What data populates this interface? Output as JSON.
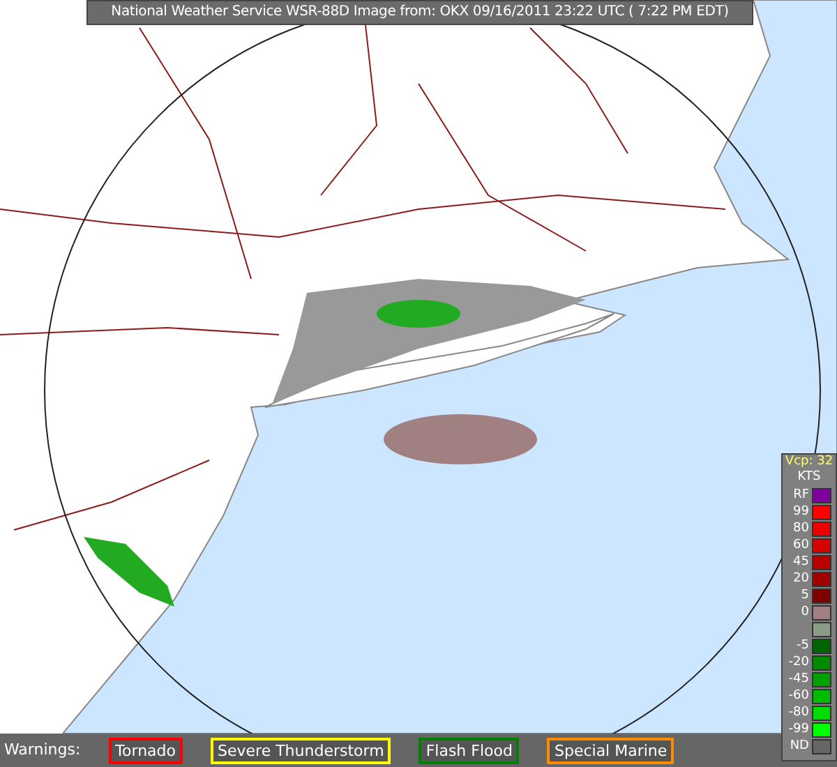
{
  "header": {
    "title": "National Weather Service WSR-88D Image from: OKX 09/16/2011  23:22 UTC ( 7:22 PM EDT)"
  },
  "legend": {
    "mode": "Vcp: 32",
    "unit": "KTS",
    "entries": [
      {
        "label": "RF",
        "color": "#8000a0"
      },
      {
        "label": "99",
        "color": "#ff0000"
      },
      {
        "label": "80",
        "color": "#ee0000"
      },
      {
        "label": "60",
        "color": "#d50000"
      },
      {
        "label": "45",
        "color": "#b80000"
      },
      {
        "label": "20",
        "color": "#a00000"
      },
      {
        "label": "5",
        "color": "#800000"
      },
      {
        "label": "0",
        "color": "#a08080"
      },
      {
        "color": "#8a9c88"
      },
      {
        "label": "-5",
        "color": "#006400"
      },
      {
        "label": "-20",
        "color": "#008a00"
      },
      {
        "label": "-45",
        "color": "#00a200"
      },
      {
        "label": "-60",
        "color": "#00bc00"
      },
      {
        "label": "-80",
        "color": "#00dc00"
      },
      {
        "label": "-99",
        "color": "#00ff00"
      },
      {
        "label": "ND",
        "color": "#666666"
      }
    ]
  },
  "warnings": {
    "label": "Warnings:",
    "items": [
      {
        "label": "Tornado",
        "color": "#ff0000"
      },
      {
        "label": "Severe Thunderstorm",
        "color": "#ffff00"
      },
      {
        "label": "Flash Flood",
        "color": "#008000"
      },
      {
        "label": "Special Marine",
        "color": "#ff8c00"
      }
    ]
  }
}
